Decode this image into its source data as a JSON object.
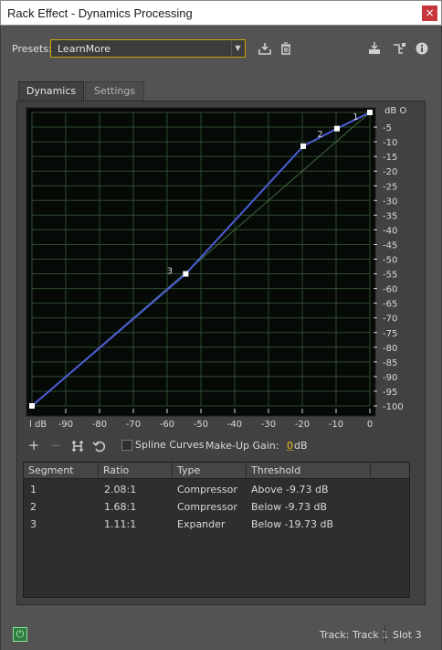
{
  "window": {
    "title": "Rack Effect - Dynamics Processing",
    "close_glyph": "×"
  },
  "presets": {
    "label": "Presets:",
    "selected": "LearnMore",
    "icons": [
      "save-preset-icon",
      "delete-preset-icon",
      "insert-icon",
      "routing-icon",
      "info-icon"
    ]
  },
  "tabs": [
    {
      "label": "Dynamics",
      "active": true
    },
    {
      "label": "Settings",
      "active": false
    }
  ],
  "graph": {
    "y_axis_label": "dB O",
    "y_ticks": [
      "-5",
      "-10",
      "-15",
      "-20",
      "-25",
      "-30",
      "-35",
      "-40",
      "-45",
      "-50",
      "-55",
      "-60",
      "-65",
      "-70",
      "-75",
      "-80",
      "-85",
      "-90",
      "-95",
      "-100"
    ],
    "x_first_label": "l dB",
    "x_ticks": [
      "-90",
      "-80",
      "-70",
      "-60",
      "-50",
      "-40",
      "-30",
      "-20",
      "-10",
      "0"
    ],
    "points": [
      {
        "input": -100,
        "output": -100
      },
      {
        "input": -54.5,
        "output": -55
      },
      {
        "input": -19.73,
        "output": -11.5
      },
      {
        "input": -9.73,
        "output": -5.5
      },
      {
        "input": 0,
        "output": 0
      }
    ],
    "segment_labels": [
      {
        "label": "1",
        "input": -4,
        "output": -1.5
      },
      {
        "label": "2",
        "input": -14.5,
        "output": -7.5
      },
      {
        "label": "3",
        "input": -59,
        "output": -54
      }
    ],
    "colors": {
      "curve": "#4d5dd6",
      "grid": "#2f4a2f",
      "background": "#060a06",
      "diagonal": "#2c4a2c"
    }
  },
  "controls": {
    "add_glyph": "+",
    "remove_glyph": "−",
    "spline_label": "Spline Curves",
    "makeup_label": "Make-Up Gain:",
    "makeup_value": "0",
    "makeup_unit": "dB"
  },
  "table": {
    "headers": [
      "Segment",
      "Ratio",
      "Type",
      "Threshold"
    ],
    "rows": [
      {
        "segment": "1",
        "ratio": "2.08:1",
        "type": "Compressor",
        "threshold": "Above -9.73 dB"
      },
      {
        "segment": "2",
        "ratio": "1.68:1",
        "type": "Compressor",
        "threshold": "Below -9.73 dB"
      },
      {
        "segment": "3",
        "ratio": "1.11:1",
        "type": "Expander",
        "threshold": "Below -19.73 dB"
      }
    ]
  },
  "status": {
    "track": "Track: Track 1",
    "slot": "Slot 3"
  }
}
